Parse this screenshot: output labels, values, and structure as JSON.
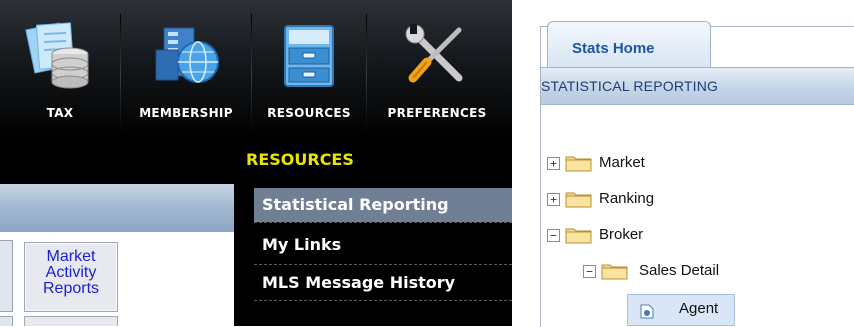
{
  "nav": {
    "items": [
      {
        "label": "TAX",
        "icon": "tax-database-icon"
      },
      {
        "label": "MEMBERSHIP",
        "icon": "membership-network-icon"
      },
      {
        "label": "RESOURCES",
        "icon": "resources-cabinet-icon"
      },
      {
        "label": "PREFERENCES",
        "icon": "preferences-tools-icon"
      }
    ]
  },
  "dropdown": {
    "title": "RESOURCES",
    "items": [
      {
        "label": "Statistical Reporting",
        "active": true
      },
      {
        "label": "My Links",
        "active": false
      },
      {
        "label": "MLS Message History",
        "active": false
      }
    ]
  },
  "tile": {
    "line1": "Market",
    "line2": "Activity",
    "line3": "Reports"
  },
  "stats": {
    "tab_label": "Stats Home",
    "header": "STATISTICAL REPORTING",
    "tree": [
      {
        "label": "Market",
        "toggle": "+"
      },
      {
        "label": "Ranking",
        "toggle": "+"
      },
      {
        "label": "Broker",
        "toggle": "−"
      },
      {
        "label": "Sales Detail",
        "toggle": "−"
      },
      {
        "label": "Agent",
        "toggle": ""
      }
    ]
  },
  "colors": {
    "menu_title": "#e8e600",
    "active_item": "#707f93",
    "tab_text": "#1e55a5",
    "link_blue": "#1a1fd6"
  }
}
